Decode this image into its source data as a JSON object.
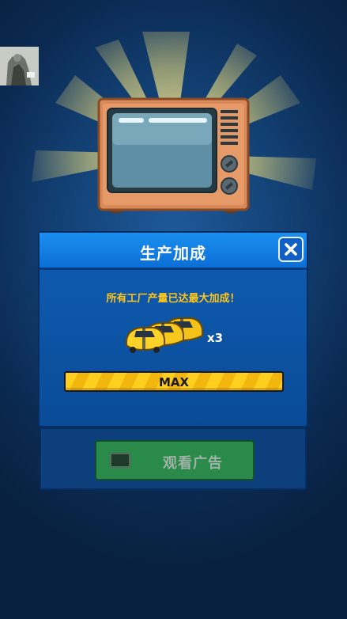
{
  "dialog": {
    "title": "生产加成",
    "message": "所有工厂产量已达最大加成！",
    "multiplier": "x3",
    "progress_label": "MAX",
    "progress_fraction": 1.0
  },
  "ad_button": {
    "label": "观看广告",
    "enabled": false
  },
  "icons": {
    "close": "close-icon",
    "tv": "tv-icon",
    "cars": "car-stack-icon",
    "ad_tv": "tv-small-icon"
  },
  "colors": {
    "accent_yellow": "#ffc61a",
    "header_blue": "#1b8ff0",
    "ad_green": "#2a8a49"
  }
}
